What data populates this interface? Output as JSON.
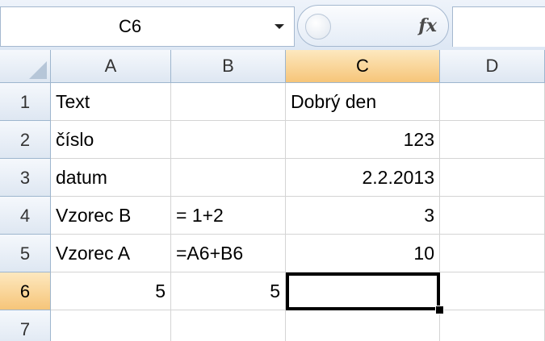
{
  "formula_bar": {
    "name_box": "C6",
    "fx_label": "fx",
    "formula": ""
  },
  "columns": [
    "A",
    "B",
    "C",
    "D"
  ],
  "rows": [
    "1",
    "2",
    "3",
    "4",
    "5",
    "6",
    "7"
  ],
  "cells": {
    "A1": "Text",
    "C1": "Dobrý den",
    "A2": "číslo",
    "C2": "123",
    "A3": "datum",
    "C3": "2.2.2013",
    "A4": "Vzorec B",
    "B4": "= 1+2",
    "C4": "3",
    "A5": "Vzorec A",
    "B5": "=A6+B6",
    "C5": "10",
    "A6": "5",
    "B6": "5",
    "C6": ""
  },
  "active_cell": "C6",
  "colors": {
    "selected_header": "#f6c579",
    "header": "#dee7f2",
    "gridline": "#d4d4d4"
  }
}
